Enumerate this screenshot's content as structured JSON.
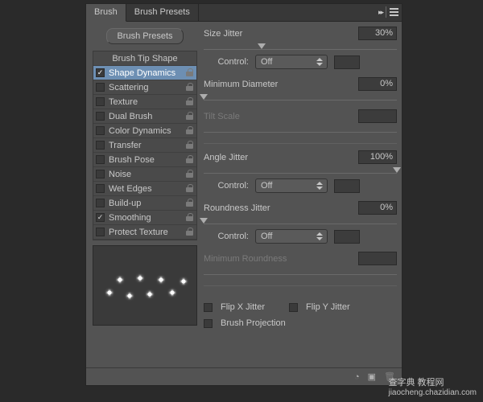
{
  "tabs": {
    "brush": "Brush",
    "presets": "Brush Presets"
  },
  "brushPresetsBtn": "Brush Presets",
  "rows": {
    "tip": "Brush Tip Shape",
    "shapeDyn": "Shape Dynamics",
    "scattering": "Scattering",
    "texture": "Texture",
    "dual": "Dual Brush",
    "colorDyn": "Color Dynamics",
    "transfer": "Transfer",
    "pose": "Brush Pose",
    "noise": "Noise",
    "wet": "Wet Edges",
    "build": "Build-up",
    "smooth": "Smoothing",
    "protect": "Protect Texture"
  },
  "labels": {
    "sizeJitter": "Size Jitter",
    "control": "Control:",
    "minDiam": "Minimum Diameter",
    "tiltScale": "Tilt Scale",
    "angleJitter": "Angle Jitter",
    "roundJitter": "Roundness Jitter",
    "minRound": "Minimum Roundness",
    "flipX": "Flip X Jitter",
    "flipY": "Flip Y Jitter",
    "brushProj": "Brush Projection"
  },
  "values": {
    "sizeJitter": "30%",
    "minDiam": "0%",
    "angleJitter": "100%",
    "roundJitter": "0%",
    "controlOff": "Off"
  },
  "watermark": {
    "main": "查字典 教程网",
    "sub": "jiaocheng.chazidian.com"
  }
}
